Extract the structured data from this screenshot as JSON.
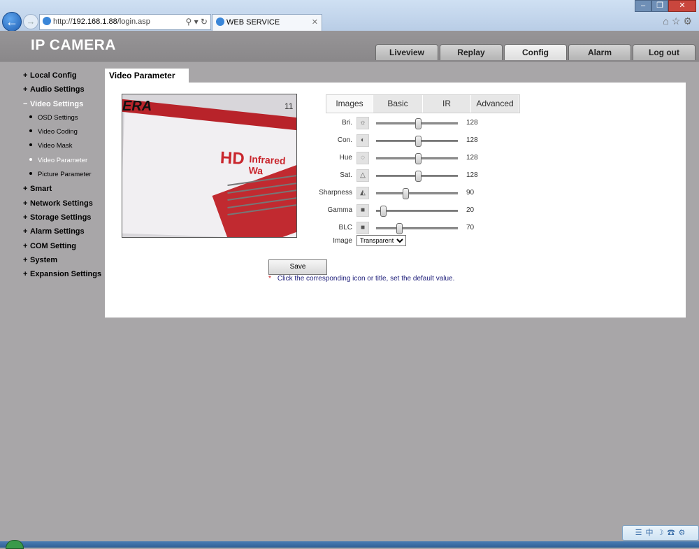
{
  "browser": {
    "address_prefix": "http://",
    "address_host": "192.168.1.88",
    "address_path": "/login.asp",
    "tab_title": "WEB SERVICE"
  },
  "header": {
    "brand": "IP CAMERA",
    "nav": [
      "Liveview",
      "Replay",
      "Config",
      "Alarm",
      "Log out"
    ],
    "active_nav": "Config"
  },
  "sidebar": {
    "before_open": [
      "Local Config",
      "Audio Settings"
    ],
    "open_section": "Video Settings",
    "sub_items": [
      "OSD Settings",
      "Video Coding",
      "Video Mask",
      "Video Parameter",
      "Picture Parameter"
    ],
    "active_sub": "Video Parameter",
    "after_open": [
      "Smart",
      "Network Settings",
      "Storage Settings",
      "Alarm Settings",
      "COM Setting",
      "System",
      "Expansion Settings"
    ]
  },
  "panel": {
    "title": "Video Parameter",
    "subtabs": [
      "Images",
      "Basic",
      "IR",
      "Advanced"
    ],
    "active_subtab": "Images",
    "sliders": [
      {
        "label": "Bri.",
        "value": 128,
        "icon": "brightness-icon",
        "glyph": "☼"
      },
      {
        "label": "Con.",
        "value": 128,
        "icon": "contrast-icon",
        "glyph": "◐"
      },
      {
        "label": "Hue",
        "value": 128,
        "icon": "hue-icon",
        "glyph": "◌"
      },
      {
        "label": "Sat.",
        "value": 128,
        "icon": "saturation-icon",
        "glyph": "△"
      },
      {
        "label": "Sharpness",
        "value": 90,
        "icon": "sharpness-icon",
        "glyph": "◭"
      },
      {
        "label": "Gamma",
        "value": 20,
        "icon": "gamma-icon",
        "glyph": "■"
      },
      {
        "label": "BLC",
        "value": 70,
        "icon": "blc-icon",
        "glyph": "■"
      }
    ],
    "slider_max": 255,
    "image_label": "Image",
    "image_value": "Transparent",
    "save_label": "Save",
    "note_marker": "*",
    "note": "Click the corresponding icon or title, set the default value."
  },
  "preview": {
    "brand_text": "ERA",
    "number_text": "11",
    "hd_text": "HD",
    "infrared_text": "Infrared Wa"
  }
}
